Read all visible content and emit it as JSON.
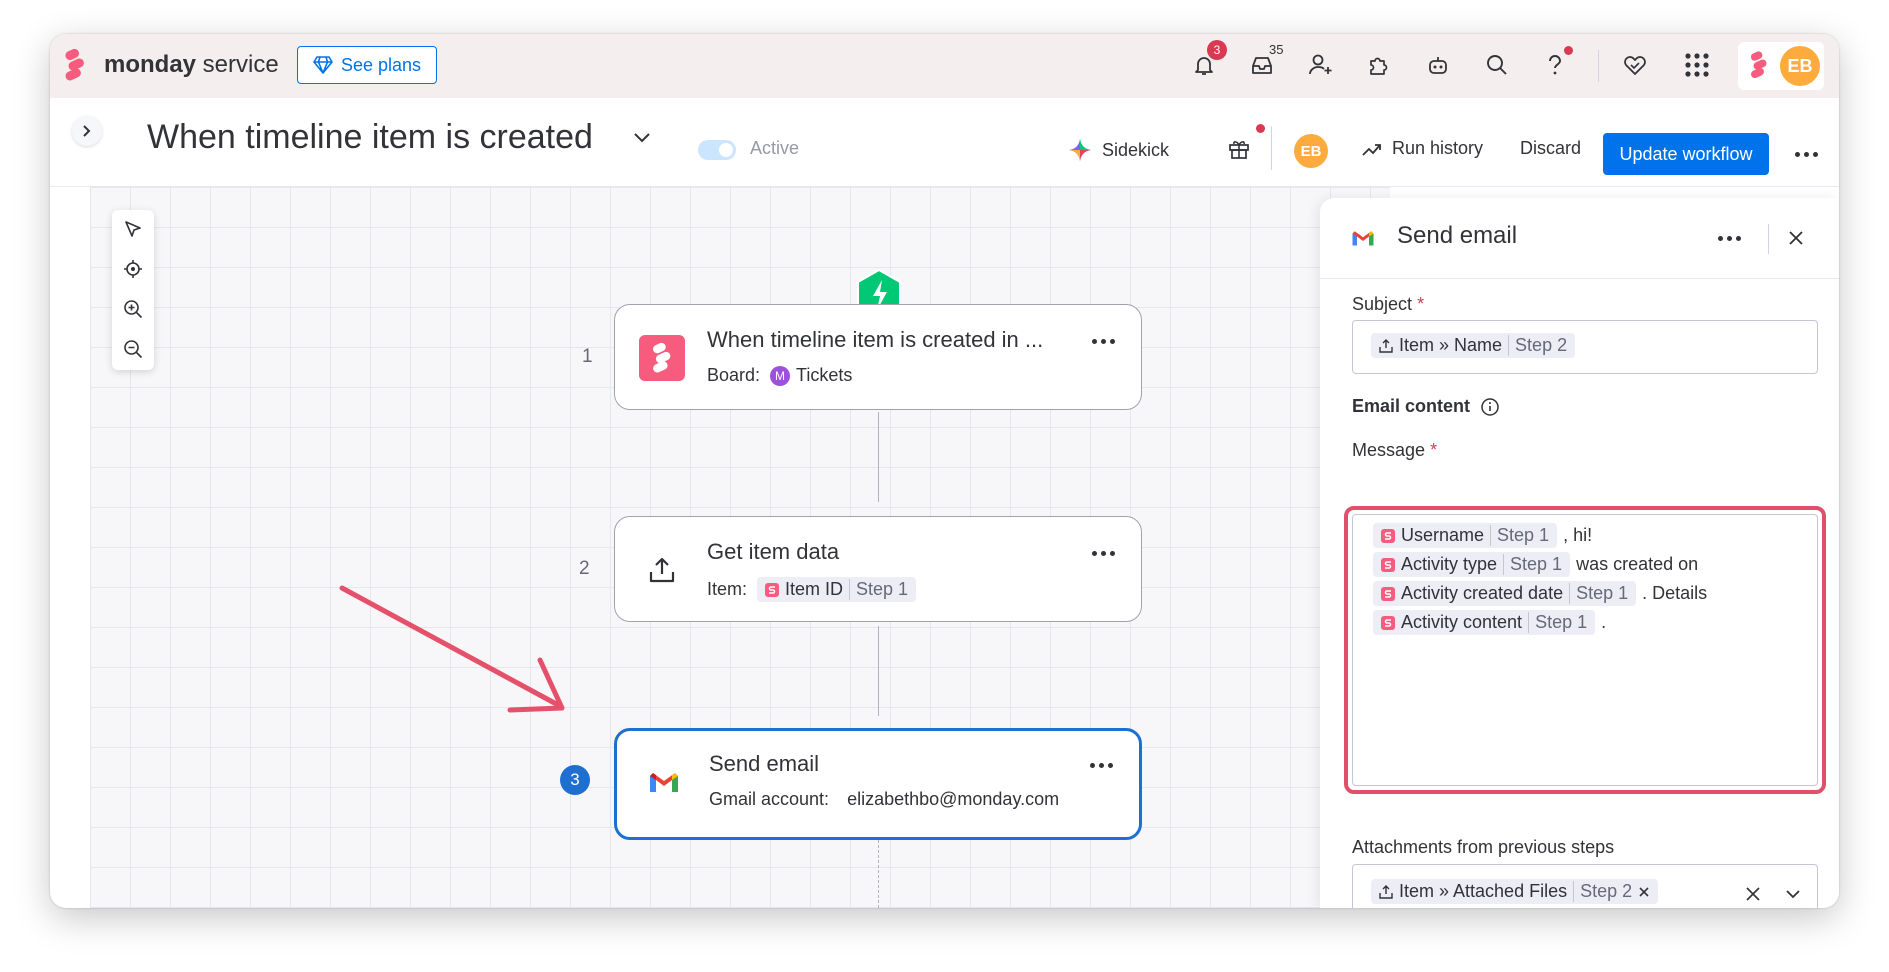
{
  "brand": {
    "name_bold": "monday",
    "name_rest": " service"
  },
  "topbar": {
    "see_plans": "See plans",
    "notifications_badge": "3",
    "inbox_count": "35",
    "avatar": "EB"
  },
  "header": {
    "title": "When timeline item is created",
    "status": "Active",
    "sidekick": "Sidekick",
    "avatar": "EB",
    "run_history": "Run history",
    "discard": "Discard",
    "update_workflow": "Update workflow"
  },
  "workflow": {
    "steps": [
      {
        "number": "1",
        "title": "When timeline item is created in ...",
        "sub_label": "Board:",
        "board_initial": "M",
        "board_name": "Tickets"
      },
      {
        "number": "2",
        "title": "Get item data",
        "sub_label": "Item:",
        "chip_label": "Item ID",
        "chip_step": "Step 1"
      },
      {
        "number": "3",
        "title": "Send email",
        "sub_label": "Gmail account:",
        "sub_value": "elizabethbo@monday.com"
      }
    ]
  },
  "panel": {
    "title": "Send email",
    "subject_label": "Subject",
    "subject_chip_label": "Item » Name",
    "subject_chip_step": "Step 2",
    "email_content": "Email content",
    "message_label": "Message",
    "message_lines": [
      {
        "chip_label": "Username",
        "chip_step": "Step 1",
        "text": ", hi!"
      },
      {
        "chip_label": "Activity type",
        "chip_step": "Step 1",
        "text": " was created on"
      },
      {
        "chip_label": "Activity created date",
        "chip_step": "Step 1",
        "text": ". Details"
      },
      {
        "chip_label": "Activity content",
        "chip_step": "Step 1",
        "text": "."
      }
    ],
    "attachments_label": "Attachments from previous steps",
    "attachment_chip_label": "Item » Attached Files",
    "attachment_chip_step": "Step 2"
  },
  "colors": {
    "accent": "#0073ea",
    "brand_pink": "#f75b7e",
    "highlight": "#e0506a",
    "trigger_green": "#00c875"
  }
}
